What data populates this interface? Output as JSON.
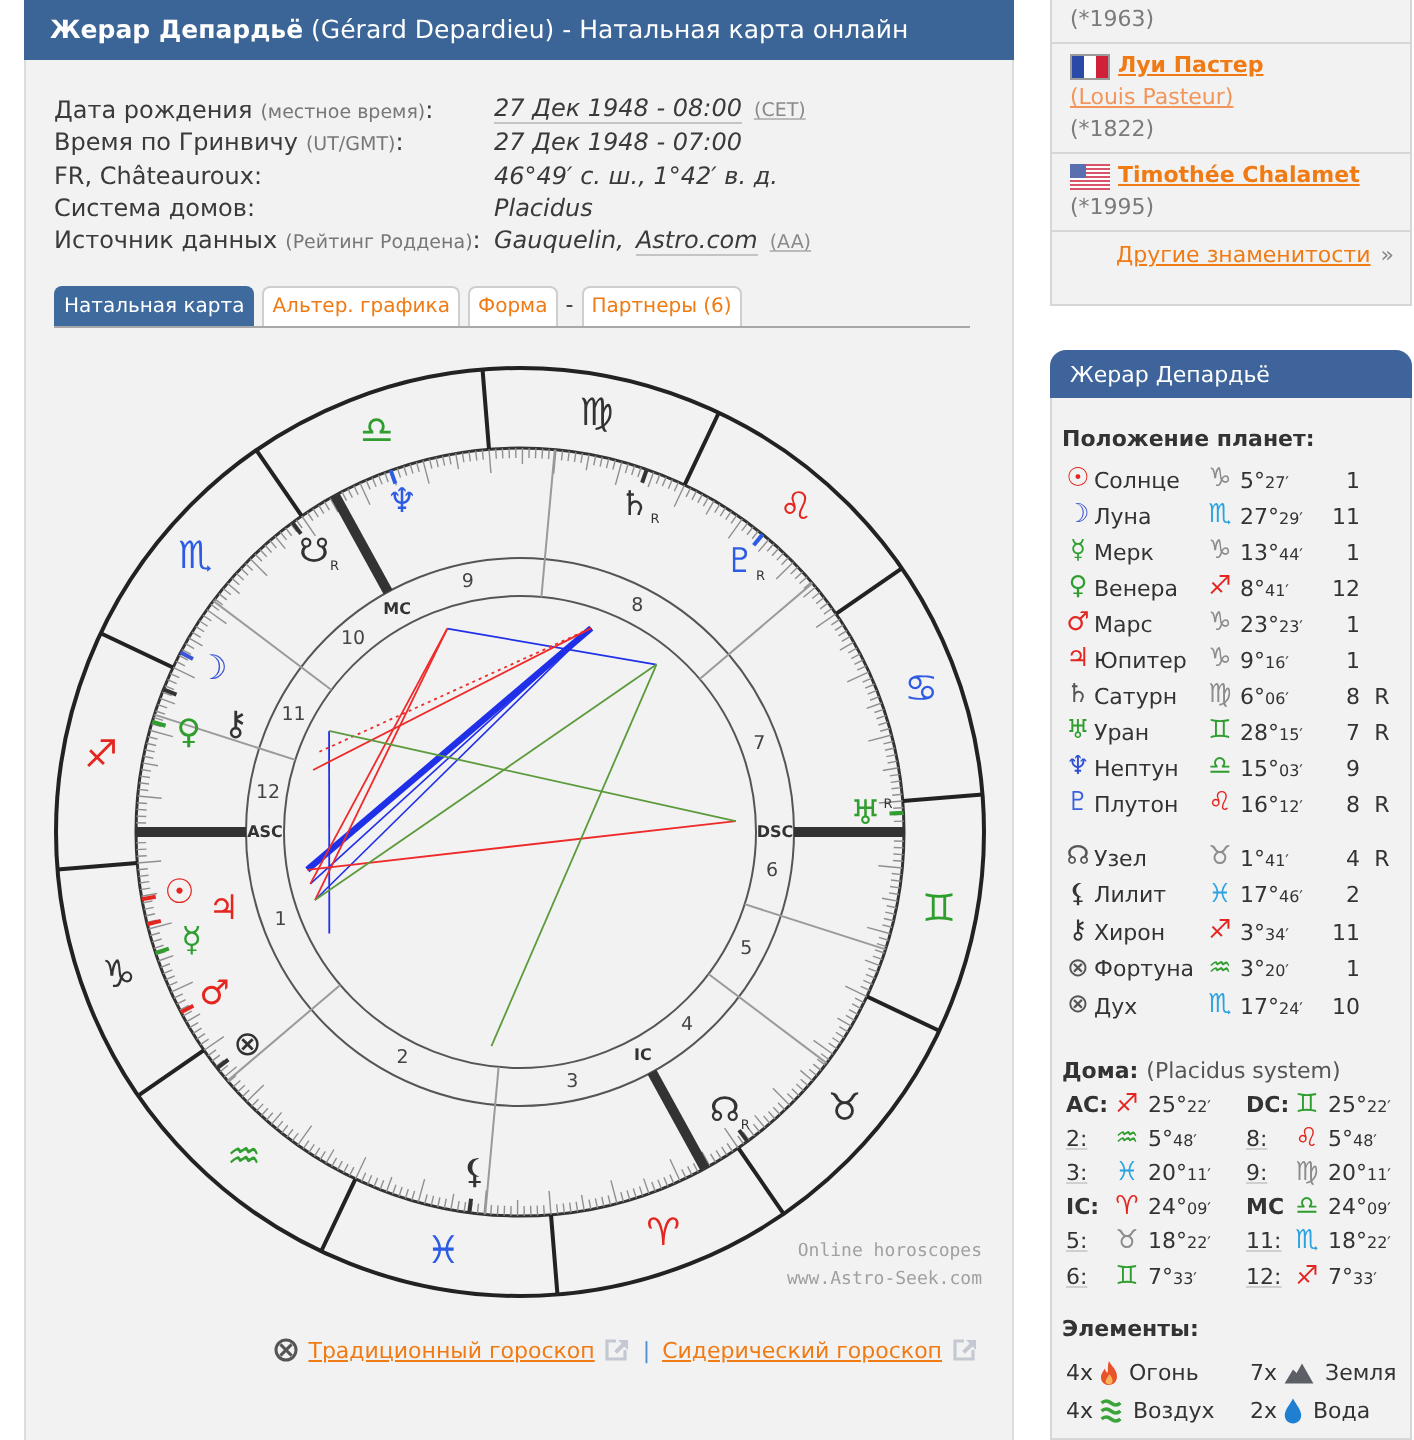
{
  "header": {
    "title": "**Жерар Депардьё** (Gérard Depardieu) - Натальная карта онлайн"
  },
  "details": [
    {
      "label": "Дата рождения",
      "note": "(местное время)",
      "suffix": ":",
      "value": [
        {
          "kind": "link",
          "text": "27 Дек 1948 - 08:00"
        },
        {
          "kind": "small-link",
          "text": "(CET)"
        }
      ]
    },
    {
      "label": "Время по Гринвичу",
      "note": "(UT/GMT)",
      "suffix": ":",
      "value": [
        {
          "kind": "text",
          "text": "27 Дек 1948 - 07:00"
        }
      ]
    },
    {
      "label": "FR, Châteauroux:",
      "value": [
        {
          "kind": "text",
          "text": "46°49′ с. ш., 1°42′ в. д."
        }
      ]
    },
    {
      "label": "Система домов:",
      "value": [
        {
          "kind": "text",
          "text": "Placidus"
        }
      ]
    },
    {
      "label": "Источник данных",
      "note": "(Рейтинг Роддена)",
      "suffix": ":",
      "value": [
        {
          "kind": "text",
          "text": "Gauquelin,"
        },
        {
          "kind": "link",
          "text": "Astro.com"
        },
        {
          "kind": "small-link",
          "text": "(AA)"
        }
      ]
    }
  ],
  "tabs": [
    {
      "kind": "tab",
      "label": "Натальная карта",
      "selected": true
    },
    {
      "kind": "tab",
      "label": "Альтер. графика",
      "selected": false
    },
    {
      "kind": "tab",
      "label": "Форма",
      "selected": false
    },
    {
      "kind": "separator",
      "label": "-"
    },
    {
      "kind": "tab",
      "label": "Партнеры (6)",
      "selected": false
    }
  ],
  "chart": {
    "signs": [
      {
        "symbol": "♈",
        "color": "#e3261f"
      },
      {
        "symbol": "♉",
        "color": "#333333"
      },
      {
        "symbol": "♊",
        "color": "#2f9e2f"
      },
      {
        "symbol": "♋",
        "color": "#2d5be3"
      },
      {
        "symbol": "♌",
        "color": "#e3261f"
      },
      {
        "symbol": "♍",
        "color": "#333333"
      },
      {
        "symbol": "♎",
        "color": "#2f9e2f"
      },
      {
        "symbol": "♏",
        "color": "#2d5be3"
      },
      {
        "symbol": "♐",
        "color": "#e3261f"
      },
      {
        "symbol": "♑",
        "color": "#333333"
      },
      {
        "symbol": "♒",
        "color": "#2f9e2f"
      },
      {
        "symbol": "♓",
        "color": "#2d5be3"
      }
    ],
    "houses": [
      {
        "number": "1",
        "angle": "ASC"
      },
      {
        "number": "2"
      },
      {
        "number": "3"
      },
      {
        "number": "4",
        "angle": "IC"
      },
      {
        "number": "5"
      },
      {
        "number": "6"
      },
      {
        "number": "7",
        "angle": "DSC"
      },
      {
        "number": "8"
      },
      {
        "number": "9"
      },
      {
        "number": "10",
        "angle": "MC"
      },
      {
        "number": "11"
      },
      {
        "number": "12"
      }
    ],
    "planets": [
      {
        "symbol": "♆",
        "color": "#2d5be3"
      },
      {
        "symbol": "♄",
        "color": "#333333",
        "retro": "R"
      },
      {
        "symbol": "☋",
        "color": "#333333",
        "retro": "R"
      },
      {
        "symbol": "♇",
        "color": "#2d5be3",
        "retro": "R"
      },
      {
        "symbol": "☽",
        "color": "#3a55d4"
      },
      {
        "symbol": "⚷",
        "color": "#333333"
      },
      {
        "symbol": "♀",
        "color": "#2f9e2f"
      },
      {
        "symbol": "♅",
        "color": "#2f9e2f",
        "retro": "R"
      },
      {
        "symbol": "☉",
        "color": "#e3261f"
      },
      {
        "symbol": "♃",
        "color": "#e3261f"
      },
      {
        "symbol": "☿",
        "color": "#2f9e2f"
      },
      {
        "symbol": "♂",
        "color": "#e3261f"
      },
      {
        "symbol": "⊗",
        "color": "#333333"
      },
      {
        "symbol": "☊",
        "color": "#333333",
        "retro": "R"
      },
      {
        "symbol": "⚸",
        "color": "#333333"
      }
    ],
    "credit": [
      "Online horoscopes",
      "www.Astro-Seek.com"
    ]
  },
  "chart_links": {
    "items": [
      {
        "label": "Традиционный гороскоп"
      },
      {
        "label": "Сидерический гороскоп"
      }
    ],
    "separator": "|"
  },
  "famous": {
    "entries": [
      {
        "born": "(*1963)"
      },
      {
        "flag": {
          "kind": "france"
        },
        "name": "Луи Пастер",
        "alt_name": "(Louis Pasteur)",
        "born": "(*1822)"
      },
      {
        "flag": {
          "kind": "usa"
        },
        "name": "Timothée Chalamet",
        "born": "(*1995)"
      }
    ],
    "more": {
      "label": "Другие знаменитости",
      "mark": "»"
    }
  },
  "profile": {
    "title": "Жерар Депардьё",
    "planets_title": "Положение планет:",
    "planets": [
      {
        "symbol": "☉",
        "color": "#e3261f",
        "name": "Солнце",
        "sign": {
          "symbol": "♑",
          "color": "#8c8c8c"
        },
        "degrees": "5°",
        "minutes": "27′",
        "house": "1"
      },
      {
        "symbol": "☽",
        "color": "#3a55d4",
        "name": "Луна",
        "sign": {
          "symbol": "♏",
          "color": "#2aa3e0"
        },
        "degrees": "27°",
        "minutes": "29′",
        "house": "11"
      },
      {
        "symbol": "☿",
        "color": "#2f9e2f",
        "name": "Мерк",
        "sign": {
          "symbol": "♑",
          "color": "#8c8c8c"
        },
        "degrees": "13°",
        "minutes": "44′",
        "house": "1"
      },
      {
        "symbol": "♀",
        "color": "#2f9e2f",
        "name": "Венера",
        "sign": {
          "symbol": "♐",
          "color": "#e3261f"
        },
        "degrees": "8°",
        "minutes": "41′",
        "house": "12"
      },
      {
        "symbol": "♂",
        "color": "#e3261f",
        "name": "Марс",
        "sign": {
          "symbol": "♑",
          "color": "#8c8c8c"
        },
        "degrees": "23°",
        "minutes": "23′",
        "house": "1"
      },
      {
        "symbol": "♃",
        "color": "#e3261f",
        "name": "Юпитер",
        "sign": {
          "symbol": "♑",
          "color": "#8c8c8c"
        },
        "degrees": "9°",
        "minutes": "16′",
        "house": "1"
      },
      {
        "symbol": "♄",
        "color": "#555555",
        "name": "Сатурн",
        "sign": {
          "symbol": "♍",
          "color": "#8c8c8c"
        },
        "degrees": "6°",
        "minutes": "06′",
        "house": "8",
        "retro": "R"
      },
      {
        "symbol": "♅",
        "color": "#2f9e2f",
        "name": "Уран",
        "sign": {
          "symbol": "♊",
          "color": "#2f9e2f"
        },
        "degrees": "28°",
        "minutes": "15′",
        "house": "7",
        "retro": "R"
      },
      {
        "symbol": "♆",
        "color": "#2d4fd6",
        "name": "Нептун",
        "sign": {
          "symbol": "♎",
          "color": "#2f9e2f"
        },
        "degrees": "15°",
        "minutes": "03′",
        "house": "9"
      },
      {
        "symbol": "♇",
        "color": "#3a5fe0",
        "name": "Плутон",
        "sign": {
          "symbol": "♌",
          "color": "#e3261f"
        },
        "degrees": "16°",
        "minutes": "12′",
        "house": "8",
        "retro": "R"
      }
    ],
    "points": [
      {
        "symbol": "☊",
        "color": "#555555",
        "name": "Узел",
        "sign": {
          "symbol": "♉",
          "color": "#8c8c8c"
        },
        "degrees": "1°",
        "minutes": "41′",
        "house": "4",
        "retro": "R"
      },
      {
        "symbol": "⚸",
        "color": "#333333",
        "name": "Лилит",
        "sign": {
          "symbol": "♓",
          "color": "#2aa3e0"
        },
        "degrees": "17°",
        "minutes": "46′",
        "house": "2"
      },
      {
        "symbol": "⚷",
        "color": "#333333",
        "name": "Хирон",
        "sign": {
          "symbol": "♐",
          "color": "#e3261f"
        },
        "degrees": "3°",
        "minutes": "34′",
        "house": "11"
      },
      {
        "symbol": "⊗",
        "color": "#555555",
        "name": "Фортуна",
        "sign": {
          "symbol": "♒",
          "color": "#2f9e2f"
        },
        "degrees": "3°",
        "minutes": "20′",
        "house": "1"
      },
      {
        "symbol": "⊗",
        "color": "#555555",
        "name": "Дух",
        "sign": {
          "symbol": "♏",
          "color": "#2aa3e0"
        },
        "degrees": "17°",
        "minutes": "24′",
        "house": "10"
      }
    ],
    "houses_title": "Дома:",
    "houses_note": "(Placidus system)",
    "houses": [
      {
        "kind": "angle",
        "label": "AC:",
        "sign": {
          "symbol": "♐",
          "color": "#e3261f"
        },
        "degrees": "25°",
        "minutes": "22′"
      },
      {
        "kind": "angle",
        "label": "DC:",
        "sign": {
          "symbol": "♊",
          "color": "#2f9e2f"
        },
        "degrees": "25°",
        "minutes": "22′"
      },
      {
        "kind": "cusp",
        "label": "2:",
        "sign": {
          "symbol": "♒",
          "color": "#2f9e2f"
        },
        "degrees": "5°",
        "minutes": "48′"
      },
      {
        "kind": "cusp",
        "label": "8:",
        "sign": {
          "symbol": "♌",
          "color": "#e3261f"
        },
        "degrees": "5°",
        "minutes": "48′"
      },
      {
        "kind": "cusp",
        "label": "3:",
        "sign": {
          "symbol": "♓",
          "color": "#2aa3e0"
        },
        "degrees": "20°",
        "minutes": "11′"
      },
      {
        "kind": "cusp",
        "label": "9:",
        "sign": {
          "symbol": "♍",
          "color": "#8c8c8c"
        },
        "degrees": "20°",
        "minutes": "11′"
      },
      {
        "kind": "angle",
        "label": "IC:",
        "sign": {
          "symbol": "♈",
          "color": "#e3261f"
        },
        "degrees": "24°",
        "minutes": "09′"
      },
      {
        "kind": "angle",
        "label": "MC",
        "sign": {
          "symbol": "♎",
          "color": "#2f9e2f"
        },
        "degrees": "24°",
        "minutes": "09′"
      },
      {
        "kind": "cusp",
        "label": "5:",
        "sign": {
          "symbol": "♉",
          "color": "#8c8c8c"
        },
        "degrees": "18°",
        "minutes": "22′"
      },
      {
        "kind": "cusp",
        "label": "11:",
        "sign": {
          "symbol": "♏",
          "color": "#2aa3e0"
        },
        "degrees": "18°",
        "minutes": "22′"
      },
      {
        "kind": "cusp",
        "label": "6:",
        "sign": {
          "symbol": "♊",
          "color": "#2f9e2f"
        },
        "degrees": "7°",
        "minutes": "33′"
      },
      {
        "kind": "cusp",
        "label": "12:",
        "sign": {
          "symbol": "♐",
          "color": "#e3261f"
        },
        "degrees": "7°",
        "minutes": "33′"
      }
    ],
    "elements_title": "Элементы:",
    "elements": [
      {
        "count": "4x",
        "kind": "fire",
        "label": "Огонь"
      },
      {
        "count": "7x",
        "kind": "earth",
        "label": "Земля"
      },
      {
        "count": "4x",
        "kind": "air",
        "label": "Воздух"
      },
      {
        "count": "2x",
        "kind": "water",
        "label": "Вода"
      }
    ]
  }
}
